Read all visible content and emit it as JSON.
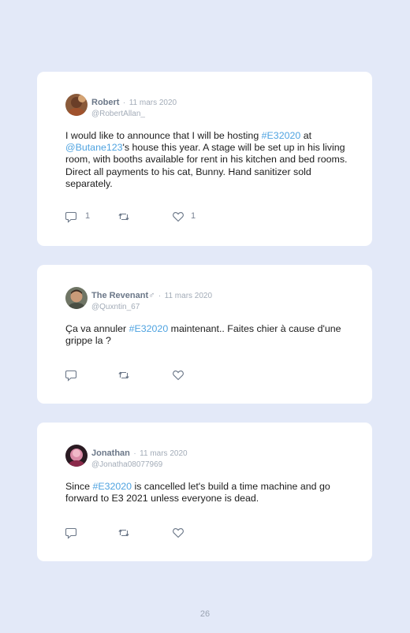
{
  "tweets": [
    {
      "name": "Robert",
      "separator": "·",
      "date": "11 mars 2020",
      "handle": "@RobertAllan_",
      "text_parts": [
        "I would like to announce that I will be hosting ",
        "#E32020",
        " at ",
        "@Butane123",
        "'s house this year. A stage will be set up in his living room, with booths available for rent in his kitchen and bed rooms. Direct all payments to his cat, Bunny. Hand sanitizer sold separately."
      ],
      "reply_count": "1",
      "retweet_count": "",
      "like_count": "1"
    },
    {
      "name": "The Revenant",
      "gender_icon": "♂",
      "separator": "·",
      "date": "11 mars 2020",
      "handle": "@Quxntin_67",
      "text_parts": [
        "Ça va annuler ",
        "#E32020",
        " maintenant.. Faites chier à cause d'une grippe la ?"
      ],
      "reply_count": "",
      "retweet_count": "",
      "like_count": ""
    },
    {
      "name": "Jonathan",
      "separator": "·",
      "date": "11 mars 2020",
      "handle": "@Jonatha08077969",
      "text_parts": [
        "Since ",
        "#E32020",
        " is cancelled let's build a time machine and go forward to E3 2021 unless everyone is dead."
      ],
      "reply_count": "",
      "retweet_count": "",
      "like_count": ""
    }
  ],
  "colors": {
    "background": "#e3e9f8",
    "card": "#ffffff",
    "hashtag": "#4fa3e0",
    "muted": "#a3acb8"
  },
  "icons": {
    "reply": "reply-icon",
    "retweet": "retweet-icon",
    "like": "like-icon",
    "gender": "male-sign-icon"
  },
  "page_number": "26"
}
